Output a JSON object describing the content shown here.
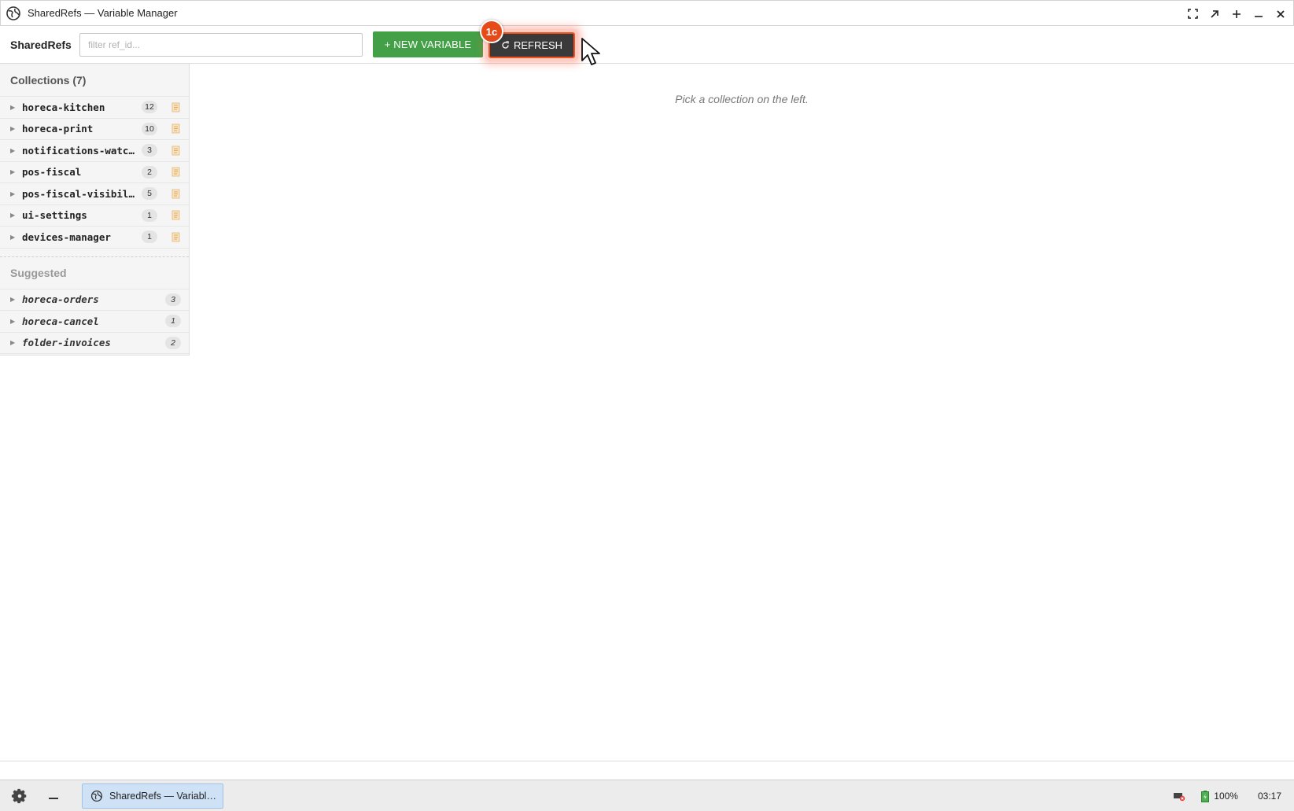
{
  "window": {
    "title": "SharedRefs — Variable Manager",
    "icons": [
      "app-globe-icon",
      "fullscreen-icon",
      "restore-icon",
      "maximize-icon",
      "minimize-icon",
      "close-icon"
    ]
  },
  "toolbar": {
    "brand": "SharedRefs",
    "filter_placeholder": "filter ref_id...",
    "filter_value": "",
    "new_variable_label": "+ NEW VARIABLE",
    "refresh_label": "REFRESH",
    "step_badge": "1c"
  },
  "sidebar": {
    "collections_title": "Collections (7)",
    "collections": [
      {
        "name": "horeca-kitchen",
        "count": "12"
      },
      {
        "name": "horeca-print",
        "count": "10"
      },
      {
        "name": "notifications-watch…",
        "count": "3"
      },
      {
        "name": "pos-fiscal",
        "count": "2"
      },
      {
        "name": "pos-fiscal-visibili…",
        "count": "5"
      },
      {
        "name": "ui-settings",
        "count": "1"
      },
      {
        "name": "devices-manager",
        "count": "1"
      }
    ],
    "suggested_title": "Suggested",
    "suggested": [
      {
        "name": "horeca-orders",
        "count": "3"
      },
      {
        "name": "horeca-cancel",
        "count": "1"
      },
      {
        "name": "folder-invoices",
        "count": "2"
      }
    ]
  },
  "main": {
    "hint": "Pick a collection on the left."
  },
  "taskbar": {
    "task_label": "SharedRefs — Variabl…",
    "battery": "100%",
    "clock": "03:17"
  },
  "colors": {
    "accent_green": "#43a047",
    "refresh_dark": "#3a3a3a",
    "highlight_orange": "#e64a19"
  }
}
